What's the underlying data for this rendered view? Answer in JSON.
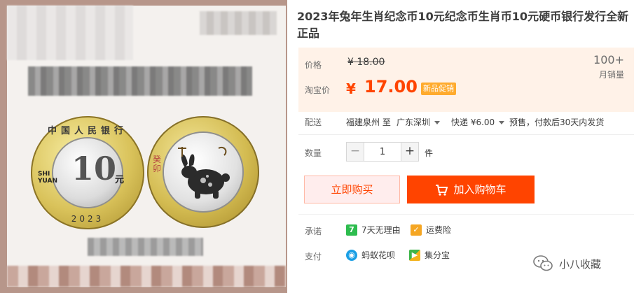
{
  "product": {
    "title": "2023年兔年生肖纪念币10元纪念币生肖币10元硬币银行发行全新正品",
    "coin_front": {
      "ring_text": "中国人民银行",
      "denomination": "10",
      "unit_cn": "元",
      "shi": "SHI",
      "yuan": "YUAN",
      "year": "2023"
    },
    "coin_back": {
      "zodiac_text": "癸卯"
    }
  },
  "price": {
    "label": "价格",
    "original": "18.00",
    "currency": "¥",
    "taobao_label": "淘宝价",
    "sale": "17.00",
    "promo_badge": "新品促销",
    "sales_count": "100+",
    "sales_label": "月销量"
  },
  "shipping": {
    "label": "配送",
    "from": "福建泉州 至",
    "to": "广东深圳",
    "method": "快递 ¥6.00",
    "note": "预售，付款后30天内发货"
  },
  "quantity": {
    "label": "数量",
    "minus": "−",
    "value": "1",
    "plus": "+",
    "unit": "件"
  },
  "actions": {
    "buy_now": "立即购买",
    "add_to_cart": "加入购物车"
  },
  "services": {
    "promise_label": "承诺",
    "promise_items": [
      "7天无理由",
      "运费险"
    ],
    "payment_label": "支付",
    "payment_items": [
      "蚂蚁花呗",
      "集分宝"
    ]
  },
  "watermark": {
    "account": "小八收藏"
  },
  "colors": {
    "accent": "#ff4400",
    "price_bg": "#fff2e8",
    "promo": "#ffab2e"
  }
}
